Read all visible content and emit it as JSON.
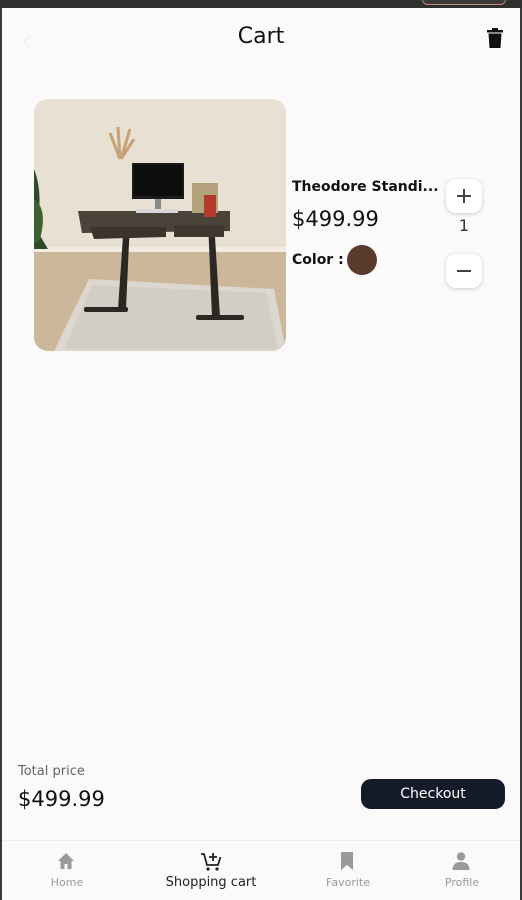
{
  "header": {
    "title": "Cart",
    "back_icon": "arrow-left-icon",
    "delete_icon": "trash-icon"
  },
  "cart": {
    "items": [
      {
        "name": "Theodore Standi...",
        "price": "$499.99",
        "color_label": "Color :",
        "color": "#5b3a2e",
        "quantity": "1",
        "image": "standing desk with monitor and plant"
      }
    ]
  },
  "summary": {
    "total_label": "Total price",
    "total_value": "$499.99",
    "checkout_label": "Checkout"
  },
  "nav": {
    "items": [
      {
        "label": "Home",
        "icon": "home-icon",
        "active": false
      },
      {
        "label": "Shopping cart",
        "icon": "cart-icon",
        "active": true
      },
      {
        "label": "Favorite",
        "icon": "bookmark-icon",
        "active": false
      },
      {
        "label": "Profile",
        "icon": "person-icon",
        "active": false
      }
    ]
  },
  "colors": {
    "accent_dark": "#151a2a",
    "background": "#fafafa",
    "inactive": "#9a9a9a"
  }
}
